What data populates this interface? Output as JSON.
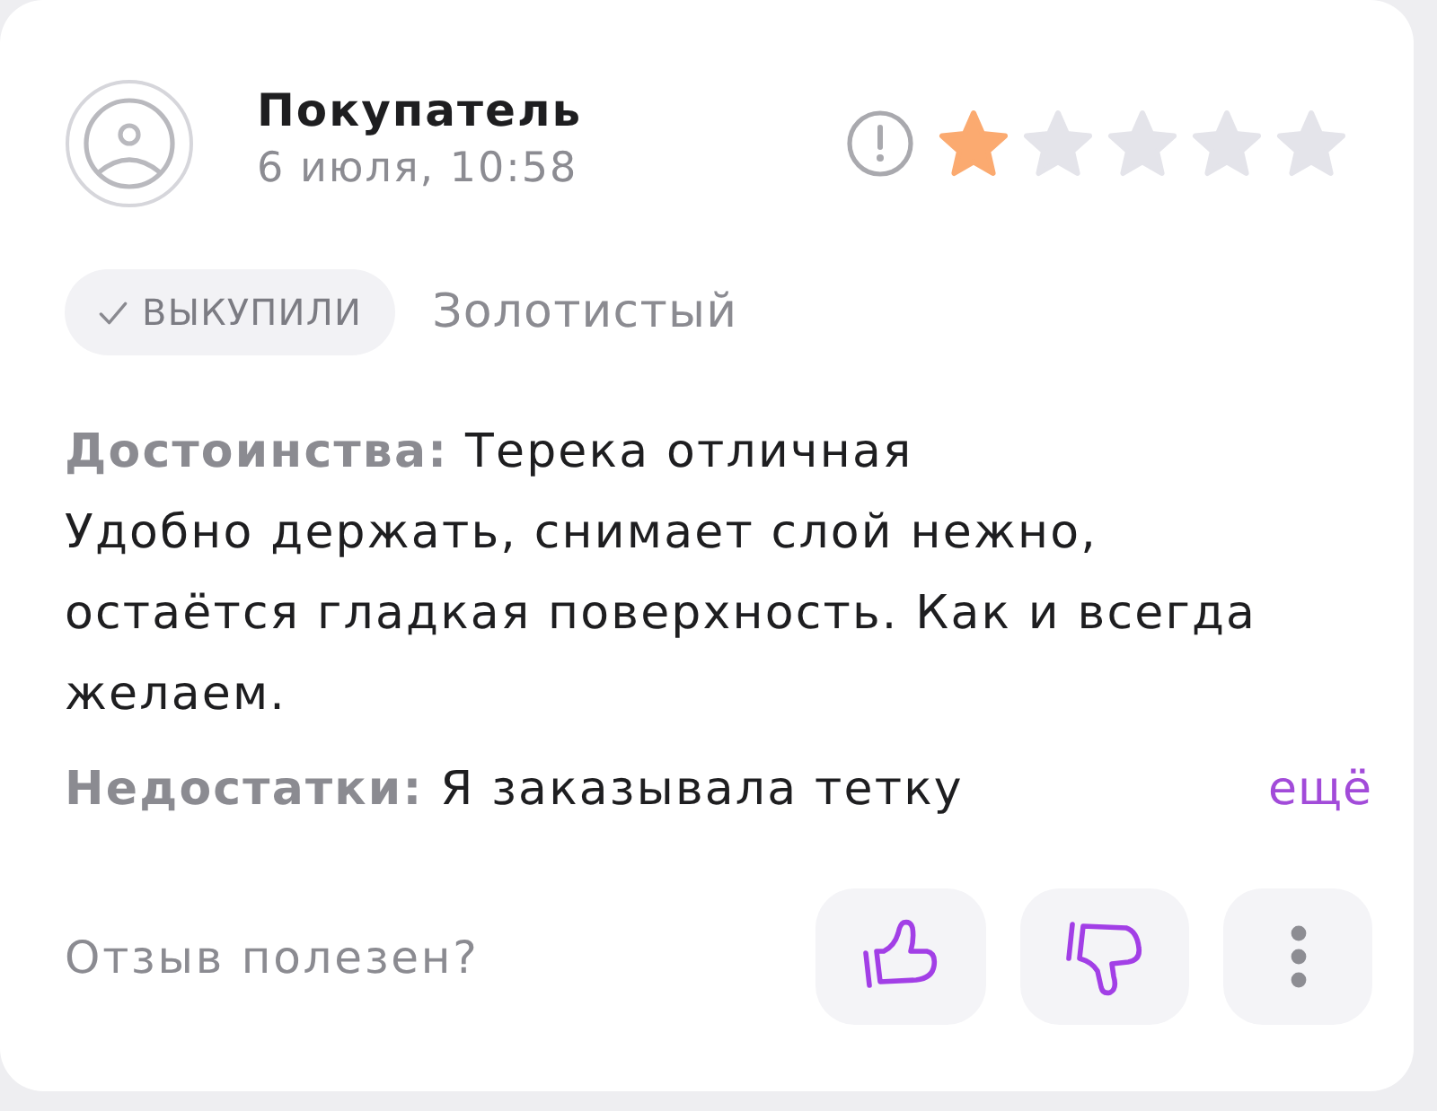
{
  "review": {
    "author": {
      "name": "Покупатель",
      "date": "6 июля, 10:58"
    },
    "rating": {
      "stars": 1
    },
    "badge": {
      "label": "ВЫКУПИЛИ"
    },
    "variant": "Золотистый",
    "sections": [
      {
        "text": "**Достоинства:** Терека отличная\nУдобно держать, снимает слой нежно, остаётся гладкая поверхность. Как и всегда желаем."
      },
      {
        "text": "**Недостатки:** Я заказывала тетку"
      }
    ],
    "more_link": "ещё",
    "helpful": {
      "question": "Отзыв полезен?"
    }
  }
}
